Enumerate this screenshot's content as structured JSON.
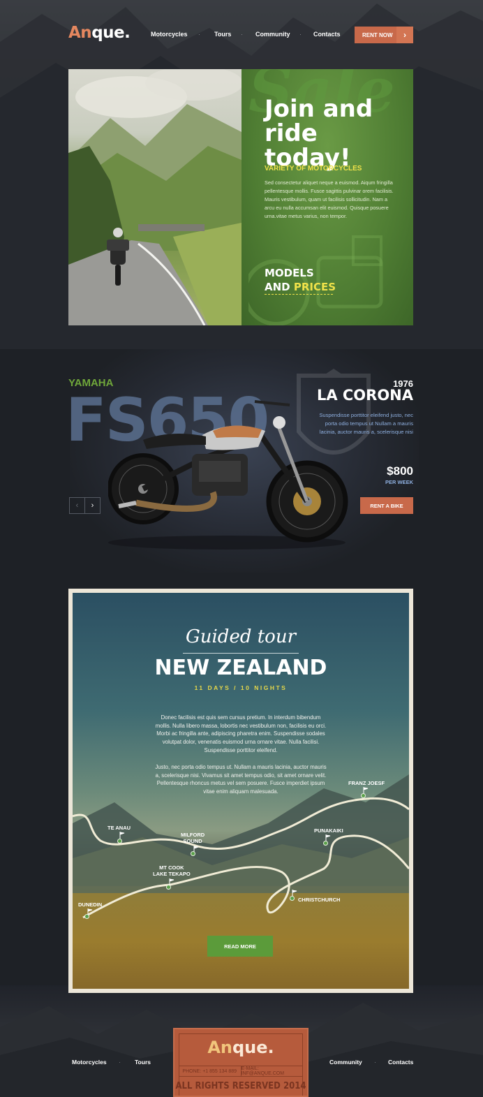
{
  "header": {
    "logo_part1": "An",
    "logo_part2": "que.",
    "nav": [
      "Motorcycles",
      "Tours",
      "Community",
      "Contacts"
    ],
    "rent_button": "RENT NOW",
    "rent_arrow_icon": "chevron-right-icon"
  },
  "hero": {
    "sale_word": "Sale",
    "title": "Join and ride today!",
    "subtitle": "VARIETY OF MOTORCYCLES",
    "text": "Sed consectetur aliquet neque a euismod. Aiqum fringilla pellentesque mollis. Fusce sagittis pulvinar orem facilisis. Mauris vestibulum, quam ut facilisis sollicitudin. Nam a arcu eu nulla accumsan elit euismod. Quisque posuere urna.vitae metus varius, non tempor.",
    "models_line1": "MODELS",
    "models_line2a": "AND ",
    "models_line2b": "PRICES"
  },
  "bike": {
    "brand": "YAMAHA",
    "model": "FS650",
    "year": "1976",
    "name": "LA CORONA",
    "description": "Suspendisse porttitor eleifend justo, nec porta odio tempus ut Nullam a mauris lacinia, auctor mauris a, scelerisque nisi",
    "price": "$800",
    "per": "PER WEEK",
    "rent_button": "RENT A BIKE",
    "prev_icon": "chevron-left-icon",
    "next_icon": "chevron-right-icon"
  },
  "tour": {
    "guided": "Guided tour",
    "title": "NEW ZEALAND",
    "duration": "11 DAYS / 10 NIGHTS",
    "paragraph1": "Donec facilisis est quis sem cursus pretium. In interdum bibendum mollis. Nulla libero massa, lobortis nec vestibulum non, facilisis eu orci. Morbi ac fringilla ante, adipiscing pharetra enim. Suspendisse sodales volutpat dolor, venenatis euismod urna ornare vitae. Nulla facilisi. Suspendisse porttitor eleifend.",
    "paragraph2": "Justo, nec porta odio tempus ut. Nullam a mauris lacinia, auctor mauris a, scelerisque nisi. Vivamus sit amet tempus odio, sit amet ornare velit. Pellentesque rhoncus metus vel sem posuere. Fusce imperdiet ipsum vitae enim aliquam malesuada.",
    "places": {
      "te_anau": "TE ANAU",
      "milford_1": "MILFORD",
      "milford_2": "SOUND",
      "mtcook_1": "MT COOK",
      "mtcook_2": "LAKE TEKAPO",
      "dunedin": "DUNEDIN",
      "franz": "FRANZ JOESF",
      "punakaiki": "PUNAKAIKI",
      "christchurch": "CHRISTCHURCH"
    },
    "read_more": "READ MORE"
  },
  "footer": {
    "nav_left": [
      "Motorcycles",
      "Tours"
    ],
    "nav_right": [
      "Community",
      "Contacts"
    ],
    "logo_part1": "An",
    "logo_part2": "que.",
    "phone": "PHONE: +1 855 134 889",
    "email": "E-MAIL: INF@ANQUE.COM",
    "copyright": "ALL RIGHTS RESERVED 2014"
  },
  "colors": {
    "accent_orange": "#c8694a",
    "accent_green": "#5b9b3a",
    "accent_yellow": "#f0e24a",
    "background": "#1e2126"
  }
}
